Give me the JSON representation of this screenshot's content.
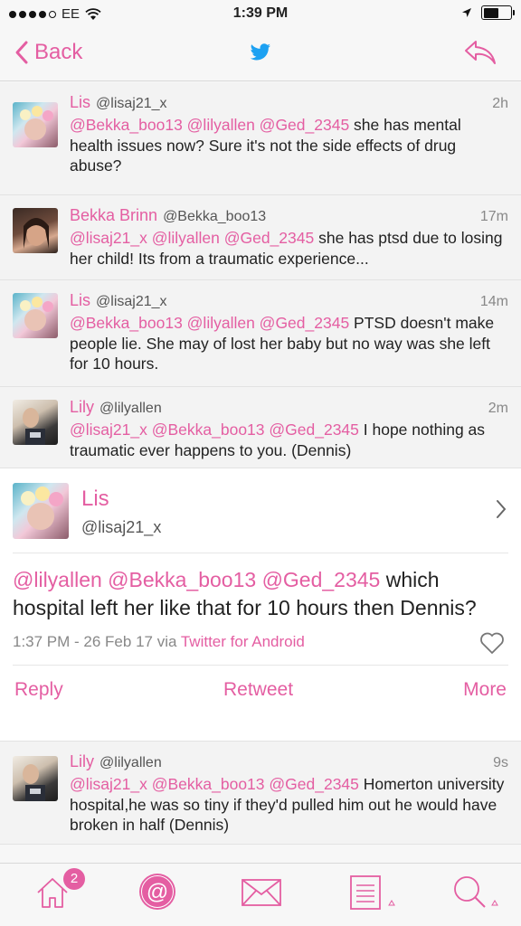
{
  "status_bar": {
    "carrier": "EE",
    "time": "1:39 PM"
  },
  "nav": {
    "back_label": "Back"
  },
  "colors": {
    "accent": "#e45ea2",
    "twitter_blue": "#1da1f2"
  },
  "tweets_above": [
    {
      "name": "Lis",
      "handle": "@lisaj21_x",
      "time": "2h",
      "mentions": "@Bekka_boo13 @lilyallen @Ged_2345",
      "text": " she has mental health issues now? Sure it's not the side effects of drug abuse?"
    },
    {
      "name": "Bekka Brinn",
      "handle": "@Bekka_boo13",
      "time": "17m",
      "mentions": "@lisaj21_x @lilyallen @Ged_2345",
      "text": " she has ptsd due to losing her child! Its from a traumatic experience..."
    },
    {
      "name": "Lis",
      "handle": "@lisaj21_x",
      "time": "14m",
      "mentions": "@Bekka_boo13 @lilyallen @Ged_2345",
      "text": " PTSD doesn't make people lie. She may of lost her baby but no way was she left for 10 hours."
    },
    {
      "name": "Lily",
      "handle": "@lilyallen",
      "time": "2m",
      "mentions": "@lisaj21_x @Bekka_boo13 @Ged_2345",
      "text": " I hope nothing as traumatic ever happens to you. (Dennis)"
    }
  ],
  "focused": {
    "name": "Lis",
    "handle": "@lisaj21_x",
    "mentions": "@lilyallen @Bekka_boo13 @Ged_2345",
    "text": " which hospital left her like that for 10 hours then Dennis?",
    "meta": "1:37 PM - 26 Feb 17 via ",
    "via": "Twitter for Android",
    "actions": {
      "reply": "Reply",
      "retweet": "Retweet",
      "more": "More"
    }
  },
  "tweets_below": [
    {
      "name": "Lily",
      "handle": "@lilyallen",
      "time": "9s",
      "mentions": "@lisaj21_x @Bekka_boo13 @Ged_2345",
      "text": " Homerton university hospital,he was so tiny if they'd pulled him out he would have broken in half (Dennis)"
    }
  ],
  "tab_bar": {
    "badge": "2"
  }
}
